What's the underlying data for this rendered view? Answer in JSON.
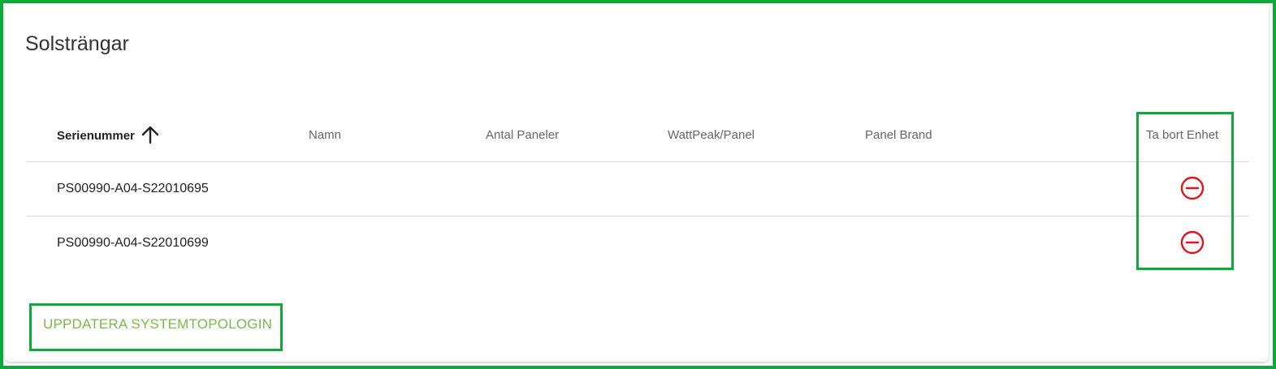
{
  "card": {
    "title": "Solsträngar"
  },
  "table": {
    "columns": {
      "serial": "Serienummer",
      "name": "Namn",
      "panel_count": "Antal Paneler",
      "watt_peak": "WattPeak/Panel",
      "brand": "Panel Brand",
      "remove": "Ta bort Enhet"
    },
    "rows": [
      {
        "serial": "PS00990-A04-S22010695",
        "name": "",
        "panel_count": "",
        "watt_peak": "",
        "brand": ""
      },
      {
        "serial": "PS00990-A04-S22010699",
        "name": "",
        "panel_count": "",
        "watt_peak": "",
        "brand": ""
      }
    ],
    "sort_icon": "arrow-up-icon",
    "remove_icon": "minus-circle-icon",
    "remove_color": "#e0141e"
  },
  "actions": {
    "update_label": "UPPDATERA SYSTEMTOPOLOGIN"
  },
  "colors": {
    "highlight": "#0fa83a",
    "link": "#7bb84a"
  }
}
